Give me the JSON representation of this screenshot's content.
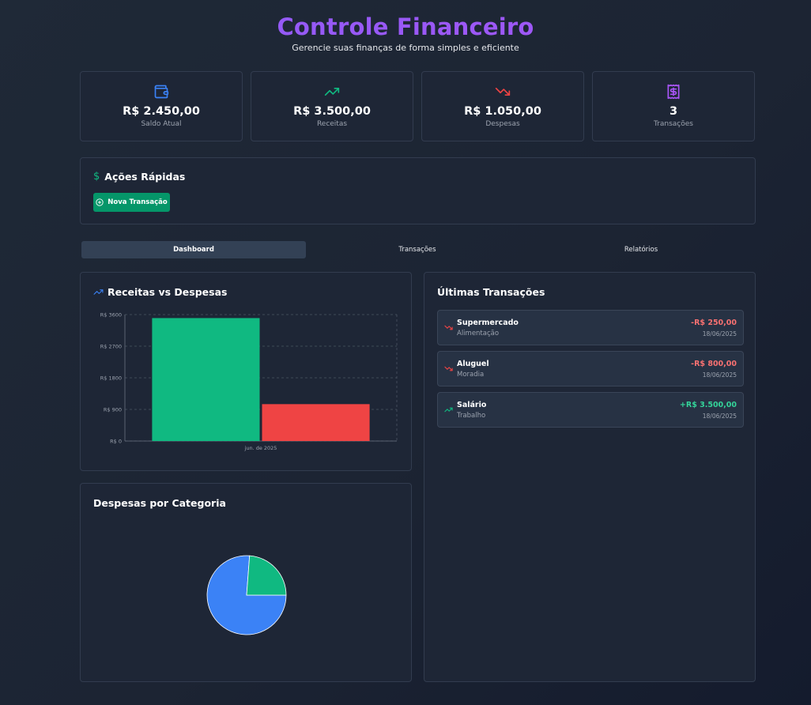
{
  "header": {
    "title": "Controle Financeiro",
    "subtitle": "Gerencie suas finanças de forma simples e eficiente"
  },
  "stats": [
    {
      "value": "R$ 2.450,00",
      "label": "Saldo Atual",
      "icon": "wallet-icon",
      "color": "#3b82f6"
    },
    {
      "value": "R$ 3.500,00",
      "label": "Receitas",
      "icon": "trending-up-icon",
      "color": "#10b981"
    },
    {
      "value": "R$ 1.050,00",
      "label": "Despesas",
      "icon": "trending-down-icon",
      "color": "#ef4444"
    },
    {
      "value": "3",
      "label": "Transações",
      "icon": "receipt-icon",
      "color": "#a855f7"
    }
  ],
  "quick_actions": {
    "title": "Ações Rápidas",
    "new_transaction_label": "Nova Transação"
  },
  "tabs": [
    {
      "label": "Dashboard",
      "active": true
    },
    {
      "label": "Transações",
      "active": false
    },
    {
      "label": "Relatórios",
      "active": false
    }
  ],
  "income_vs_expense": {
    "title": "Receitas vs Despesas"
  },
  "expenses_by_category": {
    "title": "Despesas por Categoria"
  },
  "recent_transactions": {
    "title": "Últimas Transações",
    "items": [
      {
        "name": "Supermercado",
        "category": "Alimentação",
        "amount": "-R$ 250,00",
        "date": "18/06/2025",
        "type": "expense"
      },
      {
        "name": "Aluguel",
        "category": "Moradia",
        "amount": "-R$ 800,00",
        "date": "18/06/2025",
        "type": "expense"
      },
      {
        "name": "Salário",
        "category": "Trabalho",
        "amount": "+R$ 3.500,00",
        "date": "18/06/2025",
        "type": "income"
      }
    ]
  },
  "colors": {
    "income": "#10b981",
    "expense": "#ef4444",
    "accent_purple": "#8b5cf6",
    "pie_blue": "#3b82f6",
    "pie_green": "#10b981"
  },
  "chart_data": [
    {
      "type": "bar",
      "categories": [
        "jun. de 2025"
      ],
      "series": [
        {
          "values": [
            3500
          ],
          "color": "#10b981"
        },
        {
          "values": [
            1050
          ],
          "color": "#ef4444"
        }
      ],
      "yticks": [
        "R$ 0",
        "R$ 900",
        "R$ 1800",
        "R$ 2700",
        "R$ 3600"
      ],
      "ylim": [
        0,
        3600
      ],
      "grid": true
    },
    {
      "type": "pie",
      "slices": [
        {
          "value": 800,
          "color": "#3b82f6"
        },
        {
          "value": 250,
          "color": "#10b981"
        }
      ]
    }
  ]
}
